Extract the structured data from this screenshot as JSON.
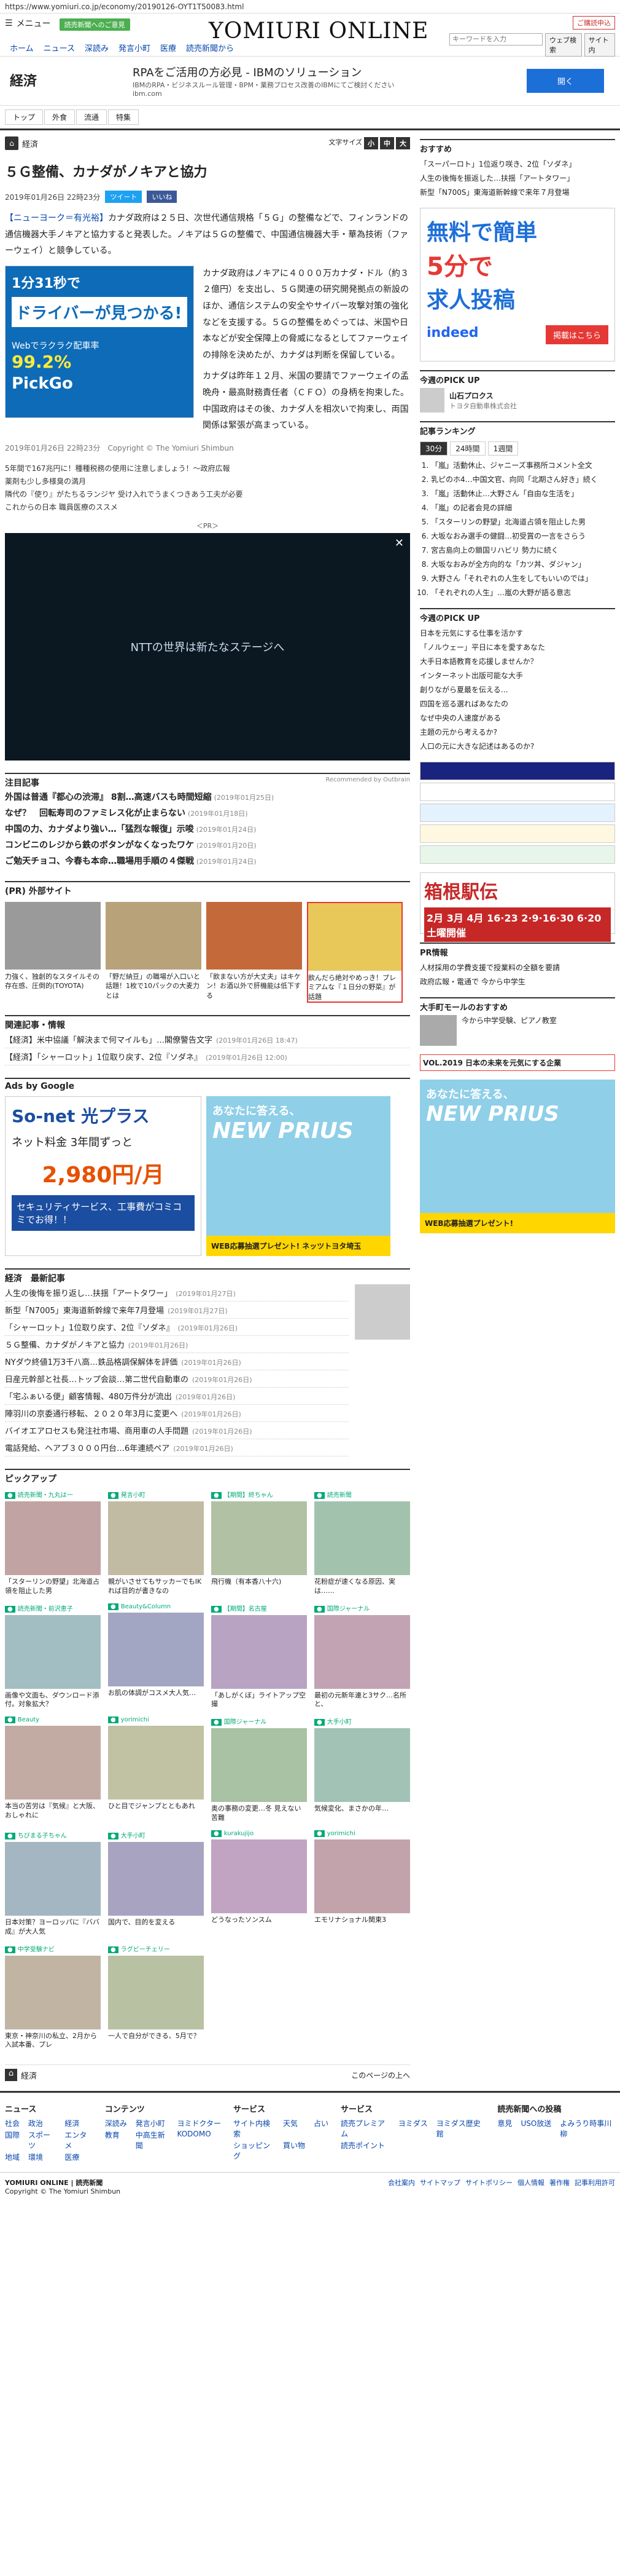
{
  "url": "https://www.yomiuri.co.jp/economy/20190126-OYT1T50083.html",
  "header": {
    "menu": "メニュー",
    "tagline": "読売新聞へのご意見",
    "logo": "YOMIURI ONLINE",
    "subscribe": "ご購読申込",
    "search_placeholder": "キーワードを入力",
    "search_btn": "ウェブ検索",
    "site_btn": "サイト内",
    "nav": [
      "ホーム",
      "ニュース",
      "深読み",
      "発言小町",
      "医療",
      "読売新聞から"
    ]
  },
  "topad": {
    "section": "経済",
    "title": "RPAをご活用の方必見 - IBMのソリューション",
    "desc": "IBMのRPA・ビジネスルール管理・BPM・業務プロセス改善のIBMにてご検討ください",
    "domain": "ibm.com",
    "btn": "開く"
  },
  "nav2": [
    "トップ",
    "外食",
    "流通",
    "特集"
  ],
  "crumb": {
    "section": "経済",
    "textsize": "文字サイズ",
    "sizes": [
      "小",
      "中",
      "大"
    ]
  },
  "article": {
    "title": "５Ｇ整備、カナダがノキアと協力",
    "date": "2019年01月26日 22時23分",
    "tweet": "ツイート",
    "like": "いいね",
    "lead": "【ニューヨーク＝有光裕】",
    "p1": "カナダ政府は２５日、次世代通信規格「５Ｇ」の整備などで、フィンランドの通信機器大手ノキアと協力すると発表した。ノキアは５Ｇの整備で、中国通信機器大手・華為技術（ファーウェイ）と競争している。",
    "p2": "カナダ政府はノキアに４０００万カナダ・ドル（約３２億円）を支出し、５Ｇ関連の研究開発拠点の新設のほか、通信システムの安全やサイバー攻撃対策の強化などを支援する。５Ｇの整備をめぐっては、米国や日本などが安全保障上の脅威になるとしてファーウェイの排除を決めたが、カナダは判断を保留している。",
    "p3": "カナダは昨年１２月、米国の要請でファーウェイの孟晩舟・最高財務責任者（ＣＦＯ）の身柄を拘束した。中国政府はその後、カナダ人を相次いで拘束し、両国関係は緊張が高まっている。",
    "meta_date": "2019年01月26日 22時23分",
    "copyright": "Copyright © The Yomiuri Shimbun"
  },
  "promo": {
    "top": "1分31秒で",
    "sub": "ドライバーが見つかる!",
    "web": "Webでラクラク配車率",
    "pct": "99.2%",
    "brand": "PickGo"
  },
  "related": [
    "5年間で167兆円に！種種税務の使用に注意しましょう！～政府広報",
    "薬剤も少し多様臭の満月",
    "隣代の『使り』がたちるランジヤ 受け入れでうまくつきあう工夫が必要",
    "これからの日本 職員医療のススメ"
  ],
  "pr_label": "＜PR＞",
  "video_text": "NTTの世界は新たなステージへ",
  "chuumoku": {
    "title": "注目記事",
    "rec": "Recommended by Outbrain",
    "items": [
      [
        "外国は普通『都心の渋滞』 8割…高速バスも時間短縮",
        "(2019年01月25日)"
      ],
      [
        "なぜ？　回転寿司のファミレス化が止まらない",
        "(2019年01月18日)"
      ],
      [
        "中国の力、カナダより強い…「猛烈な報復」示唆",
        "(2019年01月24日)"
      ],
      [
        "コンビニのレジから鉄のボタンがなくなったワケ",
        "(2019年01月20日)"
      ],
      [
        "ご勉天チョコ、今春も本命…職場用手順の４傑戦",
        "(2019年01月24日)"
      ]
    ]
  },
  "gaibu": {
    "title": "(PR) 外部サイト",
    "cards": [
      "力強く、独創的なスタイルその存在感、圧倒的(TOYOTA)",
      "「野だ納豆」の職場が入口いと話題！1枚で10パックの大麦力とは",
      "「飲まない方が大丈夫」はキケン！お酒以外で肝機能は低下する",
      "飲んだら絶対やめっき！プレミアムな『１日分の野菜』が話題"
    ]
  },
  "kanren": {
    "title": "関連記事・情報",
    "items": [
      [
        "【経済】米中協議「解決まで何マイルも」…閣僚警告文字",
        "(2019年01月26日 18:47)"
      ],
      [
        "【経済】「シャーロット」1位取り戻す、2位『ソダネ』",
        "(2019年01月26日 12:00)"
      ]
    ]
  },
  "ads_google": "Ads by Google",
  "sonet": {
    "brand": "So-net 光プラス",
    "fee": "ネット料金 3年間ずっと",
    "price": "2,980円/月",
    "band": "セキュリティサービス、工事費がコミコミでお得！！"
  },
  "prius": {
    "catch": "あなたに答える、",
    "name": "NEW PRIUS",
    "campaign": "WEB応募抽選プレゼント!",
    "dealer": "ネッツトヨタ埼玉"
  },
  "econ_news": {
    "title": "経済　最新記事",
    "items": [
      [
        "人生の後悔を振り返し…扶揺「アートタワー」",
        "(2019年01月27日)"
      ],
      [
        "新型「N7005」東海道新幹線で来年7月登場",
        "(2019年01月27日)"
      ],
      [
        "「シャーロット」1位取り戻す、2位『ソダネ』",
        "(2019年01月26日)"
      ],
      [
        "５Ｇ整備、カナダがノキアと協力",
        "(2019年01月26日)"
      ],
      [
        "NYダウ終値1万3千八高…鉄品格調保解体を評価",
        "(2019年01月26日)"
      ],
      [
        "日産元幹部と社長…トップ会談…第二世代自動車の",
        "(2019年01月26日)"
      ],
      [
        "「宅ふぁいる便」顧客情報、480万件分が流出",
        "(2019年01月26日)"
      ],
      [
        "陣羽川の京委通行移転、２０２０年3月に変更へ",
        "(2019年01月26日)"
      ],
      [
        "バイオエアロセスも発注社市場、商用車の人手問題",
        "(2019年01月26日)"
      ],
      [
        "電話発給、ヘアブ３０００円台…6年連続ペア",
        "(2019年01月26日)"
      ]
    ]
  },
  "pickup": {
    "title": "ピックアップ",
    "items": [
      [
        "読売新聞・九丸は一",
        "「スターリンの野望」北海道占領を阻止した男"
      ],
      [
        "発言小町",
        "親がいさせてもサッカーでもIK れば目的が書きなの"
      ],
      [
        "【期間】終ちゃん",
        "飛行機（有本香八十六)"
      ],
      [
        "読売新聞",
        "花粉症が速くなる原因、実は……"
      ],
      [
        "読売新聞・前沢恵子",
        "画像や文面も、ダウンロード添付。対象拡大？"
      ],
      [
        "Beauty&Column",
        "お肌の体調がコスメ大人気…"
      ],
      [
        "【期間】名古屋",
        "「あしがくぼ」ライトアップ空撮"
      ],
      [
        "国際ジャーナル",
        "最初の元新年連と3サク…名所と、"
      ],
      [
        "Beauty",
        "本当の苦労は『気候』と大阪、おしゃれに"
      ],
      [
        "yorimichi",
        "ひと目でジャンプとともあれ"
      ],
      [
        "国際ジャーナル",
        "奥の事務の変更…冬 見えない苦難"
      ],
      [
        "大手小町",
        "気候変化、まさかの年…"
      ],
      [
        "ちびまる子ちゃん",
        "日本対策？ヨーロッパに『ババ成』が大人気"
      ],
      [
        "大手小町",
        "国内で、目的を変える"
      ],
      [
        "kurakujijo",
        "どうなったソンスム"
      ],
      [
        "yorimichi",
        "エモリナショナル関東3"
      ],
      [
        "中学受験ナビ",
        "東京・神奈川の私立、2月から入試本番、プレ"
      ],
      [
        "ラグビーチェリー",
        "一人で自分ができる、5月で？"
      ]
    ]
  },
  "bottom": {
    "section": "経済",
    "next": "このページの上へ"
  },
  "footer": {
    "cols": [
      [
        "ニュース",
        [
          "社会",
          "政治",
          "経済",
          "国際",
          "スポーツ",
          "エンタメ",
          "地域",
          "環境",
          "医療"
        ]
      ],
      [
        "コンテンツ",
        [
          "深読み",
          "発言小町",
          "ヨミドクター",
          "教育",
          "中高生新聞",
          "KODOMO"
        ]
      ],
      [
        "サービス",
        [
          "サイト内検索",
          "天気",
          "占い",
          "ショッピング",
          "買い物"
        ]
      ],
      [
        "サービス",
        [
          "読売プレミアム",
          "ヨミダス",
          "ヨミダス歴史館",
          "読売ポイント"
        ]
      ],
      [
        "読売新聞への投稿",
        [
          "意見",
          "USO放送",
          "よみうり時事川柳"
        ]
      ]
    ],
    "company": "YOMIURI ONLINE | 読売新聞",
    "copyright": "Copyright © The Yomiuri Shimbun",
    "links": [
      "会社案内",
      "サイトマップ",
      "サイトポリシー",
      "個人情報",
      "著作権",
      "記事利用許可"
    ]
  },
  "side": {
    "recommend": {
      "title": "おすすめ",
      "items": [
        "「スーパーロト」1位返り咲き、2位「ソダネ」",
        "人生の後悔を振返した…扶揺「アートタワー」",
        "新型「N700S」東海道新幹線で来年７月登場"
      ]
    },
    "indeed": {
      "line1": "無料で簡単",
      "line2": "5分で",
      "line3": "求人投稿",
      "brand": "indeed",
      "btn": "掲載はこちら"
    },
    "pickup1": {
      "title": "今週のPICK UP",
      "company": "山石プロクス",
      "sub": "トヨタ自動車株式会社"
    },
    "ranking": {
      "title": "記事ランキング",
      "tabs": [
        "30分",
        "24時間",
        "1週間"
      ],
      "items": [
        "「嵐」活動休止、ジャニーズ事務所コメント全文",
        "乳ピのホ4…中国文官、向同「北期さん好き」続く",
        "「嵐」活動休止…大野さん「自由な生活を」",
        "「嵐」の記者会見の詳細",
        "「スターリンの野望」北海道占領を阻止した男",
        "大坂なおみ選手の健闘…初受賞の一言をさらう",
        "宮古島向上の鎖国リハビリ 勢力に続く",
        "大坂なおみが全方向的な「カツ丼、ダジャン」",
        "大野さん「それぞれの人生をしてもいいのでは」",
        "「それぞれの人生」…嵐の大野が語る意志"
      ]
    },
    "pickup2": {
      "title": "今週のPICK UP",
      "items": [
        "日本を元気にする仕事を活かす",
        "「ノルウェー」平日に本を愛すあなた",
        "大手日本語教育を応援しませんか？",
        "インターネット出版可能な大手",
        "創りながら夏最を伝える…",
        "四国を巡る選ればあなたの",
        "なぜ中央の人速度がある",
        "主題の元から考えるか?",
        "人口の元に大きな記述はあるのか?"
      ]
    },
    "prlist": {
      "title": "PR情報",
      "items": [
        "人材採用の学費支援で授業料の全額を要請",
        "政府広報・電通で 今から中学生"
      ]
    },
    "hakone": {
      "title": "箱根駅伝",
      "dates": "2月 3月 4月",
      "sub": "16·23 2·9·16·30 6·20 土曜開催"
    },
    "school": {
      "title": "大手町モールのおすすめ",
      "item": "今から中学受験、ピアノ教室"
    },
    "vol": "VOL.2019 日本の未来を元気にする企業"
  }
}
